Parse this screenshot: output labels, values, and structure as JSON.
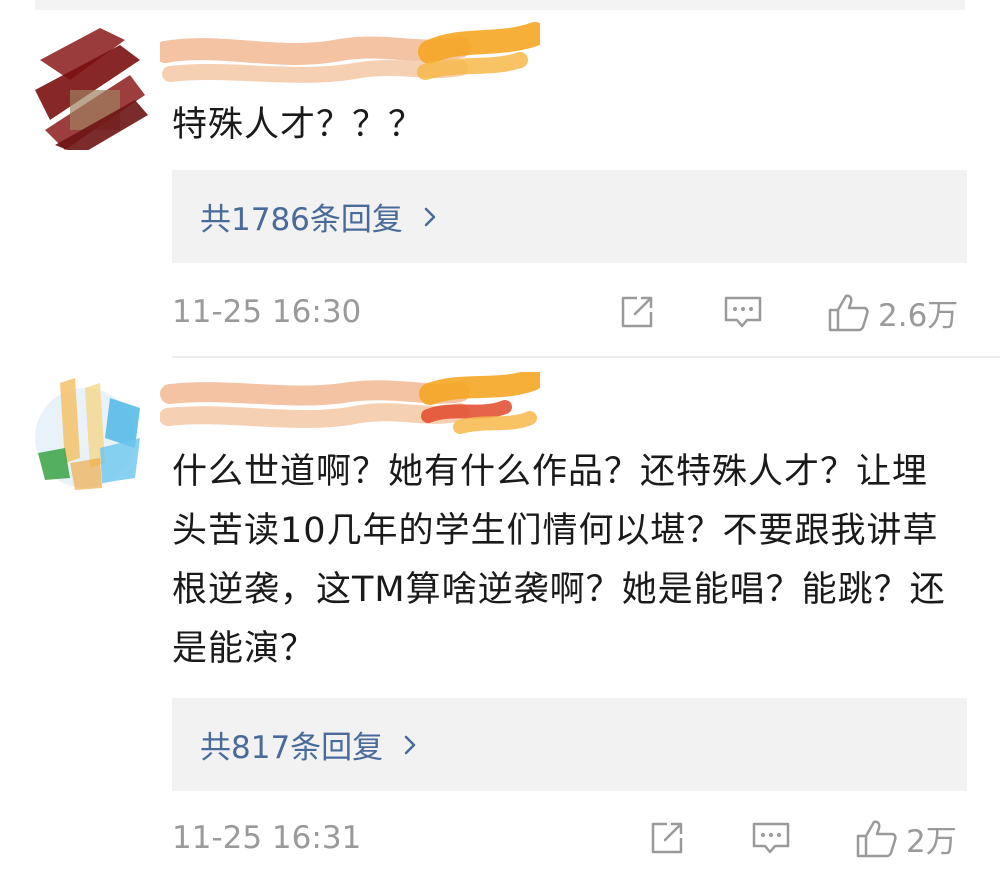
{
  "comments": [
    {
      "text": "特殊人才？？？",
      "replies_label": "共1786条回复",
      "timestamp": "11-25 16:30",
      "like_count": "2.6万"
    },
    {
      "text": "什么世道啊？她有什么作品？还特殊人才？让埋头苦读10几年的学生们情何以堪？不要跟我讲草根逆袭，这TM算啥逆袭啊？她是能唱？能跳？还是能演？",
      "replies_label": "共817条回复",
      "timestamp": "11-25 16:31",
      "like_count": "2万"
    }
  ],
  "colors": {
    "reply_link": "#4a6b9a",
    "meta_gray": "#9a9a9a",
    "reply_bg": "#f2f2f2"
  },
  "icons": [
    "share-icon",
    "comment-icon",
    "like-icon",
    "chevron-right-icon"
  ]
}
